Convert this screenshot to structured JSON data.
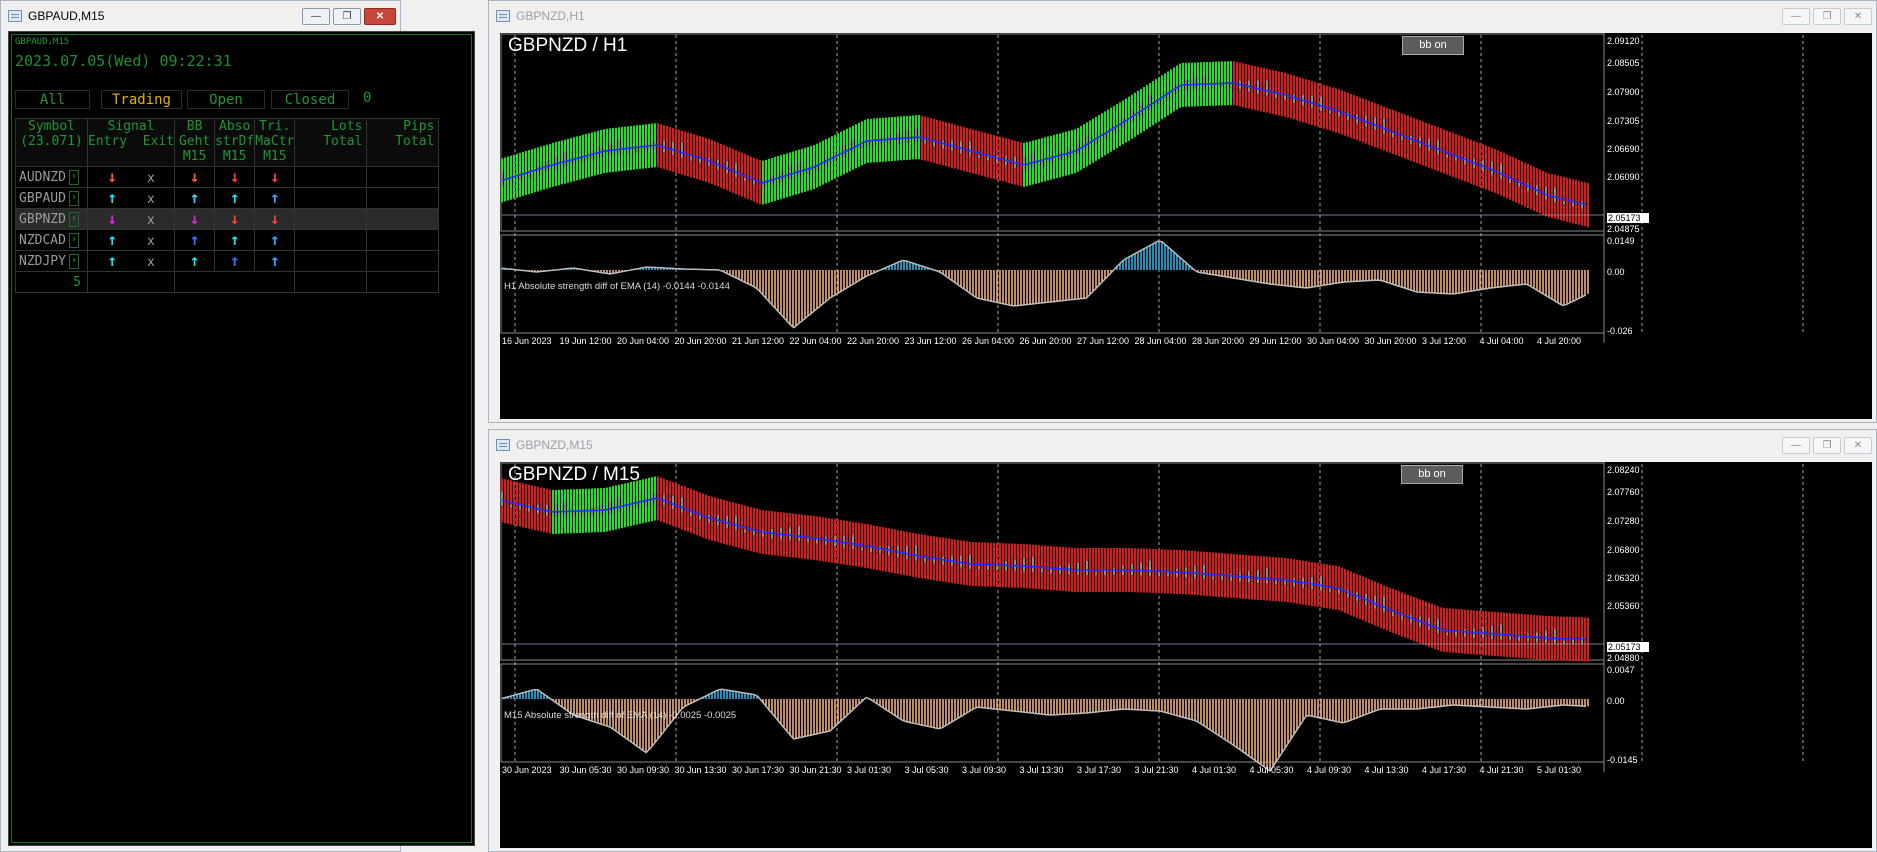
{
  "left_window": {
    "title": "GBPAUD,M15",
    "small_label": "GBPAUD,M15",
    "datetime": "2023.07.05(Wed) 09:22:31",
    "filters": [
      "All",
      "Trading",
      "Open",
      "Closed"
    ],
    "filter_count": "0",
    "headers": [
      [
        "Symbol",
        "(23.071)"
      ],
      [
        "Signal",
        "Entry  Exit"
      ],
      [
        "BB",
        "Geht",
        "M15"
      ],
      [
        "Abso",
        "strDf",
        "M15"
      ],
      [
        "Tri.",
        "MaCtr",
        "M15"
      ],
      [
        "Lots",
        "Total"
      ],
      [
        "Pips",
        "Total"
      ]
    ],
    "rows": [
      {
        "symbol": "AUDNZD",
        "entry": "↓",
        "exit": "x",
        "bb": "↓",
        "abs": "↓",
        "tri": "↓",
        "entry_color": "#ff5a2a",
        "bb_color": "#ff5a2a",
        "abs_color": "#ff3b3b",
        "tri_color": "#ff3b50"
      },
      {
        "symbol": "GBPAUD",
        "entry": "↑",
        "exit": "x",
        "bb": "↑",
        "abs": "↑",
        "tri": "↑",
        "entry_color": "#1ee0f0",
        "bb_color": "#1ee0f0",
        "abs_color": "#1ee0f0",
        "tri_color": "#3aa0ff"
      },
      {
        "symbol": "GBPNZD",
        "entry": "↓",
        "exit": "x",
        "bb": "↓",
        "abs": "↓",
        "tri": "↓",
        "entry_color": "#e020e0",
        "bb_color": "#e020e0",
        "abs_color": "#ff3b3b",
        "tri_color": "#ff3b50"
      },
      {
        "symbol": "NZDCAD",
        "entry": "↑",
        "exit": "x",
        "bb": "↑",
        "abs": "↑",
        "tri": "↑",
        "entry_color": "#1ee0f0",
        "bb_color": "#3a6cff",
        "abs_color": "#1ee0f0",
        "tri_color": "#3aa0ff"
      },
      {
        "symbol": "NZDJPY",
        "entry": "↑",
        "exit": "x",
        "bb": "↑",
        "abs": "↑",
        "tri": "↑",
        "entry_color": "#1ee0f0",
        "bb_color": "#1ee0f0",
        "abs_color": "#3a6cff",
        "tri_color": "#3aa0ff"
      }
    ],
    "total_count": "5"
  },
  "chart_h1": {
    "window_title": "GBPNZD,H1",
    "chart_title": "GBPNZD / H1",
    "bb_button": "bb on",
    "prices": [
      "2.09120",
      "2.08505",
      "2.07900",
      "2.07305",
      "2.06690",
      "2.06090",
      "2.05173",
      "2.04875"
    ],
    "indicator_label": "H1 Absolute strength diff of EMA (14) -0.0144 -0.0144",
    "ind_levels": [
      "0.0149",
      "0.00",
      "-0.026"
    ],
    "x_labels": [
      "16 Jun 2023",
      "19 Jun 12:00",
      "20 Jun 04:00",
      "20 Jun 20:00",
      "21 Jun 12:00",
      "22 Jun 04:00",
      "22 Jun 20:00",
      "23 Jun 12:00",
      "26 Jun 04:00",
      "26 Jun 20:00",
      "27 Jun 12:00",
      "28 Jun 04:00",
      "28 Jun 20:00",
      "29 Jun 12:00",
      "30 Jun 04:00",
      "30 Jun 20:00",
      "3 Jul 12:00",
      "4 Jul 04:00",
      "4 Jul 20:00"
    ]
  },
  "chart_m15": {
    "window_title": "GBPNZD,M15",
    "chart_title": "GBPNZD / M15",
    "bb_button": "bb on",
    "prices": [
      "2.08240",
      "2.07760",
      "2.07280",
      "2.06800",
      "2.06320",
      "2.05360",
      "2.05173",
      "2.04880"
    ],
    "indicator_label": "M15 Absolute strength diff of EMA (14) -0.0025 -0.0025",
    "ind_levels": [
      "0.0047",
      "0.00",
      "-0.0145"
    ],
    "x_labels": [
      "30 Jun 2023",
      "30 Jun 05:30",
      "30 Jun 09:30",
      "30 Jun 13:30",
      "30 Jun 17:30",
      "30 Jun 21:30",
      "3 Jul 01:30",
      "3 Jul 05:30",
      "3 Jul 09:30",
      "3 Jul 13:30",
      "3 Jul 17:30",
      "3 Jul 21:30",
      "4 Jul 01:30",
      "4 Jul 05:30",
      "4 Jul 09:30",
      "4 Jul 13:30",
      "4 Jul 17:30",
      "4 Jul 21:30",
      "5 Jul 01:30"
    ]
  }
}
